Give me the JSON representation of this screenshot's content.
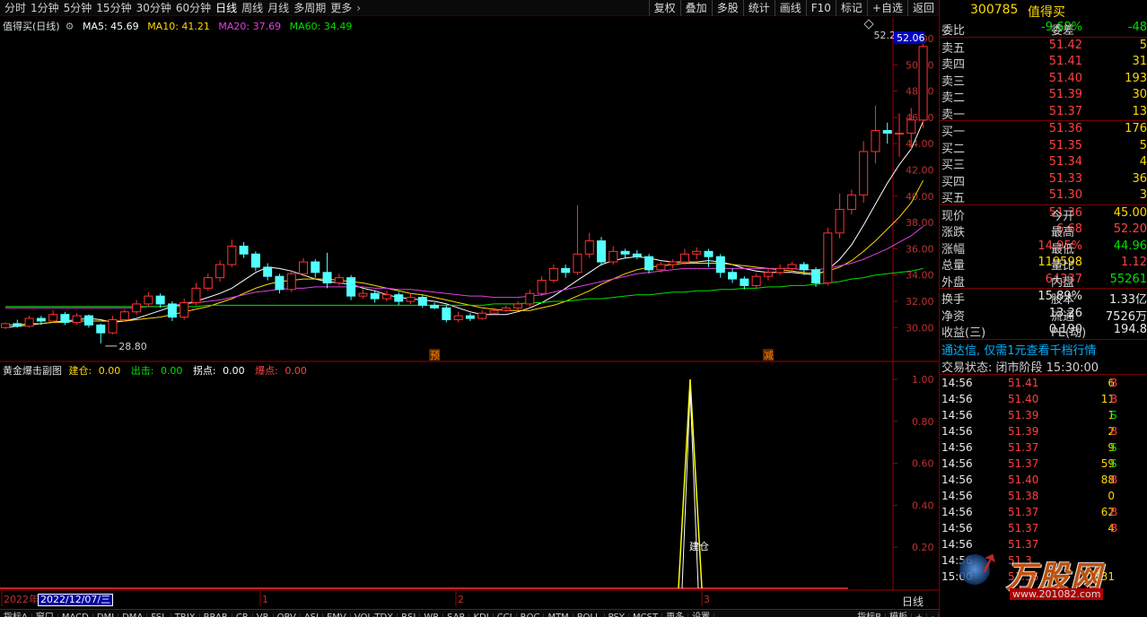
{
  "toolbar": {
    "periods": [
      "分时",
      "1分钟",
      "5分钟",
      "15分钟",
      "30分钟",
      "60分钟",
      "日线",
      "周线",
      "月线",
      "多周期",
      "更多"
    ],
    "active_period": "日线",
    "right_buttons": [
      "复权",
      "叠加",
      "多股",
      "统计",
      "画线",
      "F10",
      "标记",
      "+自选",
      "返回"
    ]
  },
  "main_info": {
    "title": "值得买(日线)",
    "ma5": "MA5: 45.69",
    "ma10": "MA10: 41.21",
    "ma20": "MA20: 37.69",
    "ma60": "MA60: 34.49"
  },
  "chart_data": [
    {
      "type": "candlestick",
      "ylim": [
        29,
        53
      ],
      "y_ticks": [
        "52.00",
        "50.00",
        "48.00",
        "46.00",
        "44.00",
        "42.00",
        "40.00",
        "38.00",
        "36.00",
        "34.00",
        "32.00",
        "30.00"
      ],
      "current_price_label": "52.06",
      "high_label": "52.20",
      "low_label": "28.80",
      "markers": [
        "预",
        "减"
      ],
      "candles": [
        [
          30.0,
          30.3,
          29.9,
          30.4
        ],
        [
          30.3,
          30.1,
          30.6,
          30.0
        ],
        [
          30.1,
          30.7,
          30.0,
          30.9
        ],
        [
          30.7,
          30.5,
          30.2,
          30.9
        ],
        [
          30.5,
          31.0,
          30.4,
          31.3
        ],
        [
          31.0,
          30.4,
          30.2,
          31.2
        ],
        [
          30.4,
          30.9,
          30.2,
          31.1
        ],
        [
          30.9,
          30.2,
          30.0,
          31.0
        ],
        [
          30.2,
          29.6,
          28.8,
          30.3
        ],
        [
          29.6,
          30.6,
          29.5,
          30.9
        ],
        [
          30.6,
          31.2,
          30.5,
          31.4
        ],
        [
          31.2,
          31.8,
          31.0,
          32.1
        ],
        [
          31.8,
          32.4,
          31.6,
          32.7
        ],
        [
          32.4,
          31.8,
          31.5,
          32.6
        ],
        [
          31.8,
          30.8,
          30.5,
          32.0
        ],
        [
          30.8,
          31.9,
          30.6,
          32.2
        ],
        [
          31.9,
          33.0,
          31.7,
          33.4
        ],
        [
          33.0,
          33.8,
          32.8,
          34.1
        ],
        [
          33.8,
          34.8,
          33.5,
          35.1
        ],
        [
          34.8,
          36.2,
          34.6,
          36.7
        ],
        [
          36.2,
          35.6,
          35.3,
          36.5
        ],
        [
          35.6,
          34.6,
          34.3,
          35.8
        ],
        [
          34.6,
          33.9,
          33.6,
          34.9
        ],
        [
          33.9,
          32.9,
          32.6,
          34.1
        ],
        [
          32.9,
          34.1,
          32.7,
          34.4
        ],
        [
          34.1,
          35.0,
          33.9,
          35.3
        ],
        [
          35.0,
          34.2,
          33.8,
          35.2
        ],
        [
          34.2,
          33.4,
          33.0,
          35.7
        ],
        [
          33.4,
          33.8,
          33.2,
          34.1
        ],
        [
          33.8,
          32.4,
          32.1,
          34.0
        ],
        [
          32.4,
          32.6,
          32.2,
          32.9
        ],
        [
          32.6,
          32.2,
          31.9,
          32.8
        ],
        [
          32.2,
          32.5,
          32.0,
          32.8
        ],
        [
          32.5,
          32.0,
          31.7,
          32.7
        ],
        [
          32.0,
          32.3,
          31.8,
          32.6
        ],
        [
          32.3,
          31.7,
          31.5,
          32.5
        ],
        [
          31.7,
          31.5,
          31.4,
          31.9
        ],
        [
          31.5,
          30.6,
          30.4,
          31.7
        ],
        [
          30.6,
          30.9,
          30.4,
          31.2
        ],
        [
          30.9,
          30.7,
          30.5,
          31.1
        ],
        [
          30.7,
          31.1,
          30.6,
          31.3
        ],
        [
          31.1,
          31.3,
          31.0,
          31.5
        ],
        [
          31.3,
          31.5,
          31.2,
          31.7
        ],
        [
          31.5,
          31.8,
          31.3,
          32.0
        ],
        [
          31.8,
          32.6,
          31.6,
          32.9
        ],
        [
          32.6,
          33.6,
          32.4,
          33.9
        ],
        [
          33.6,
          34.5,
          33.4,
          34.8
        ],
        [
          34.5,
          34.2,
          33.8,
          34.8
        ],
        [
          34.2,
          35.6,
          34.0,
          39.3
        ],
        [
          35.6,
          36.6,
          35.3,
          37.2
        ],
        [
          36.6,
          35.0,
          34.7,
          36.9
        ],
        [
          35.0,
          35.8,
          34.8,
          36.2
        ],
        [
          35.8,
          35.6,
          35.3,
          36.0
        ],
        [
          35.6,
          35.4,
          35.2,
          35.9
        ],
        [
          35.4,
          34.4,
          34.1,
          35.6
        ],
        [
          34.4,
          34.8,
          34.2,
          35.0
        ],
        [
          34.8,
          35.0,
          34.5,
          35.2
        ],
        [
          35.0,
          35.6,
          34.8,
          36.0
        ],
        [
          35.6,
          35.8,
          35.2,
          36.1
        ],
        [
          35.8,
          35.4,
          34.6,
          36.0
        ],
        [
          35.4,
          34.2,
          33.8,
          35.6
        ],
        [
          34.2,
          33.7,
          33.4,
          34.5
        ],
        [
          33.7,
          33.2,
          32.9,
          33.9
        ],
        [
          33.2,
          33.9,
          33.0,
          34.1
        ],
        [
          33.9,
          34.2,
          33.6,
          34.5
        ],
        [
          34.2,
          34.5,
          34.0,
          34.8
        ],
        [
          34.5,
          34.8,
          34.2,
          35.0
        ],
        [
          34.8,
          34.4,
          34.0,
          35.0
        ],
        [
          34.4,
          33.4,
          33.1,
          34.6
        ],
        [
          33.4,
          37.2,
          33.2,
          37.6
        ],
        [
          37.2,
          39.0,
          36.8,
          40.2
        ],
        [
          39.0,
          40.1,
          38.6,
          40.5
        ],
        [
          40.1,
          43.4,
          39.5,
          44.2
        ],
        [
          43.4,
          45.0,
          42.5,
          46.9
        ],
        [
          45.0,
          44.8,
          44.0,
          45.6
        ],
        [
          44.8,
          44.8,
          43.0,
          46.3
        ],
        [
          44.8,
          45.8,
          43.5,
          46.7
        ],
        [
          45.8,
          51.4,
          45.2,
          52.2
        ]
      ],
      "series": [
        {
          "name": "MA5",
          "values": [
            30.0,
            30.1,
            30.2,
            30.3,
            30.4,
            30.5,
            30.6,
            30.7,
            30.6,
            30.4,
            30.5,
            30.7,
            31.0,
            31.3,
            31.6,
            31.8,
            32.0,
            32.3,
            32.6,
            33.0,
            33.6,
            34.2,
            34.6,
            34.5,
            34.3,
            34.0,
            33.7,
            33.5,
            33.4,
            33.3,
            33.0,
            32.8,
            32.5,
            32.3,
            32.2,
            32.1,
            32.0,
            31.8,
            31.5,
            31.2,
            31.0,
            31.0,
            31.0,
            31.2,
            31.5,
            31.9,
            32.4,
            33.0,
            33.6,
            34.2,
            34.8,
            35.1,
            35.3,
            35.4,
            35.3,
            35.1,
            35.0,
            35.0,
            35.0,
            35.1,
            35.0,
            34.8,
            34.5,
            34.3,
            34.2,
            34.2,
            34.2,
            34.1,
            34.0,
            34.4,
            35.2,
            36.3,
            37.8,
            39.4,
            41.0,
            42.4,
            43.6,
            45.7
          ],
          "color": "#ffffff"
        },
        {
          "name": "MA10",
          "values": [
            30.2,
            30.2,
            30.3,
            30.3,
            30.4,
            30.4,
            30.5,
            30.5,
            30.5,
            30.5,
            30.5,
            30.6,
            30.7,
            30.8,
            31.0,
            31.2,
            31.4,
            31.6,
            31.9,
            32.2,
            32.6,
            33.0,
            33.3,
            33.5,
            33.6,
            33.7,
            33.7,
            33.7,
            33.6,
            33.5,
            33.4,
            33.2,
            33.0,
            32.8,
            32.6,
            32.5,
            32.3,
            32.1,
            31.9,
            31.7,
            31.5,
            31.4,
            31.3,
            31.3,
            31.3,
            31.5,
            31.7,
            32.0,
            32.4,
            32.8,
            33.3,
            33.7,
            34.1,
            34.4,
            34.6,
            34.7,
            34.8,
            34.9,
            34.9,
            34.9,
            34.9,
            34.8,
            34.7,
            34.6,
            34.5,
            34.4,
            34.3,
            34.2,
            34.1,
            34.3,
            34.6,
            35.1,
            35.8,
            36.6,
            37.5,
            38.4,
            39.5,
            41.2
          ],
          "color": "#ffd800"
        },
        {
          "name": "MA20",
          "values": [
            31.5,
            31.5,
            31.5,
            31.5,
            31.5,
            31.5,
            31.5,
            31.5,
            31.5,
            31.5,
            31.5,
            31.5,
            31.6,
            31.6,
            31.7,
            31.8,
            31.9,
            32.0,
            32.1,
            32.3,
            32.5,
            32.7,
            32.8,
            32.9,
            33.0,
            33.0,
            33.1,
            33.1,
            33.1,
            33.1,
            33.1,
            33.0,
            33.0,
            32.9,
            32.9,
            32.8,
            32.7,
            32.6,
            32.5,
            32.4,
            32.4,
            32.3,
            32.3,
            32.3,
            32.4,
            32.5,
            32.7,
            32.9,
            33.1,
            33.3,
            33.5,
            33.7,
            33.9,
            34.1,
            34.2,
            34.3,
            34.4,
            34.5,
            34.5,
            34.5,
            34.5,
            34.5,
            34.5,
            34.5,
            34.5,
            34.5,
            34.5,
            34.4,
            34.4,
            34.5,
            34.7,
            34.9,
            35.2,
            35.6,
            36.0,
            36.5,
            37.0,
            37.7
          ],
          "color": "#e040e0"
        },
        {
          "name": "MA60",
          "values": [
            31.6,
            31.6,
            31.6,
            31.6,
            31.6,
            31.6,
            31.6,
            31.6,
            31.6,
            31.6,
            31.6,
            31.6,
            31.6,
            31.6,
            31.6,
            31.6,
            31.6,
            31.7,
            31.7,
            31.7,
            31.7,
            31.7,
            31.7,
            31.7,
            31.7,
            31.7,
            31.7,
            31.7,
            31.7,
            31.7,
            31.7,
            31.7,
            31.7,
            31.7,
            31.7,
            31.7,
            31.7,
            31.7,
            31.7,
            31.7,
            31.7,
            31.8,
            31.8,
            31.8,
            31.9,
            31.9,
            32.0,
            32.0,
            32.1,
            32.2,
            32.2,
            32.3,
            32.4,
            32.5,
            32.5,
            32.6,
            32.7,
            32.7,
            32.8,
            32.8,
            32.9,
            32.9,
            33.0,
            33.0,
            33.1,
            33.1,
            33.2,
            33.2,
            33.3,
            33.4,
            33.5,
            33.7,
            33.8,
            34.0,
            34.1,
            34.2,
            34.3,
            34.5
          ],
          "color": "#00e000"
        }
      ]
    },
    {
      "type": "line",
      "ylim": [
        0,
        1.05
      ],
      "y_ticks": [
        "1.00",
        "0.80",
        "0.60",
        "0.40",
        "0.20"
      ],
      "x_labels": [
        "2022年",
        "1",
        "2",
        "3"
      ],
      "peak_value": 1.0,
      "peak_label": "建仓"
    }
  ],
  "indicator_info": {
    "name": "黄金爆击副图",
    "a_label": "建仓:",
    "a_value": "0.00",
    "b_label": "出击:",
    "b_value": "0.00",
    "c_label": "拐点:",
    "c_value": "0.00",
    "d_label": "爆点:",
    "d_value": "0.00"
  },
  "date_box": "2022/12/07/三",
  "period_label": "日线",
  "quote": {
    "code": "300785",
    "name": "值得买",
    "weibi_label": "委比",
    "weibi": "-9.68%",
    "weicha_label": "委差",
    "weicha": "-48",
    "asks": [
      {
        "label": "卖五",
        "price": "51.42",
        "vol": "5"
      },
      {
        "label": "卖四",
        "price": "51.41",
        "vol": "31"
      },
      {
        "label": "卖三",
        "price": "51.40",
        "vol": "193"
      },
      {
        "label": "卖二",
        "price": "51.39",
        "vol": "30"
      },
      {
        "label": "卖一",
        "price": "51.37",
        "vol": "13"
      }
    ],
    "bids": [
      {
        "label": "买一",
        "price": "51.36",
        "vol": "176"
      },
      {
        "label": "买二",
        "price": "51.35",
        "vol": "5"
      },
      {
        "label": "买三",
        "price": "51.34",
        "vol": "4"
      },
      {
        "label": "买四",
        "price": "51.33",
        "vol": "36"
      },
      {
        "label": "买五",
        "price": "51.30",
        "vol": "3"
      }
    ],
    "stats": [
      {
        "l1": "现价",
        "v1": "51.36",
        "l2": "今开",
        "v2": "45.00"
      },
      {
        "l1": "涨跌",
        "v1": "6.68",
        "l2": "最高",
        "v2": "52.20"
      },
      {
        "l1": "涨幅",
        "v1": "14.95%",
        "l2": "最低",
        "v2": "44.96"
      },
      {
        "l1": "总量",
        "v1": "119598",
        "l2": "量比",
        "v2": "1.12"
      },
      {
        "l1": "外盘",
        "v1": "64337",
        "l2": "内盘",
        "v2": "55261"
      }
    ],
    "stats2": [
      {
        "l1": "换手",
        "v1": "15.89%",
        "l2": "股本",
        "v2": "1.33亿"
      },
      {
        "l1": "净资",
        "v1": "13.26",
        "l2": "流通",
        "v2": "7526万"
      },
      {
        "l1": "收益(三)",
        "v1": "0.190",
        "l2": "PE(动)",
        "v2": "194.8"
      }
    ],
    "promo": "通达信, 仅需1元查看千档行情",
    "status": "交易状态: 闭市阶段 15:30:00",
    "ticks": [
      {
        "t": "14:56",
        "p": "51.41",
        "v": "6",
        "d": "B"
      },
      {
        "t": "14:56",
        "p": "51.40",
        "v": "11",
        "d": "B"
      },
      {
        "t": "14:56",
        "p": "51.39",
        "v": "1",
        "d": "S"
      },
      {
        "t": "14:56",
        "p": "51.39",
        "v": "2",
        "d": "B"
      },
      {
        "t": "14:56",
        "p": "51.37",
        "v": "9",
        "d": "S"
      },
      {
        "t": "14:56",
        "p": "51.37",
        "v": "59",
        "d": "S"
      },
      {
        "t": "14:56",
        "p": "51.40",
        "v": "88",
        "d": "B"
      },
      {
        "t": "14:56",
        "p": "51.38",
        "v": "0",
        "d": ""
      },
      {
        "t": "14:56",
        "p": "51.37",
        "v": "62",
        "d": "B"
      },
      {
        "t": "14:56",
        "p": "51.37",
        "v": "4",
        "d": "B"
      },
      {
        "t": "14:56",
        "p": "51.37",
        "v": "",
        "d": ""
      },
      {
        "t": "14:56",
        "p": "51.3",
        "v": "",
        "d": ""
      },
      {
        "t": "15:00",
        "p": "51.36",
        "v": "1831",
        "d": ""
      }
    ]
  },
  "bottom_tabs": [
    "指标A",
    "窗口",
    "MACD",
    "DMI",
    "DMA",
    "FSL",
    "TRIX",
    "BRAR",
    "CR",
    "VR",
    "OBV",
    "ASI",
    "EMV",
    "VOL-TDX",
    "RSI",
    "WR",
    "SAR",
    "KDJ",
    "CCI",
    "ROC",
    "MTM",
    "BOLL",
    "PSY",
    "MCST",
    "更多",
    "设置"
  ],
  "bottom_right": [
    "指标B",
    "模板",
    "+",
    "-"
  ],
  "watermark": "万股网 www.201082.com"
}
